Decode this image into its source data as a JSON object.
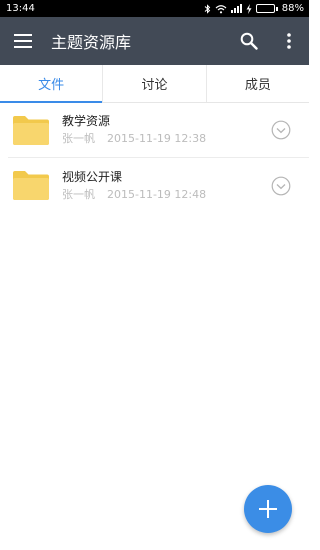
{
  "status_bar": {
    "time": "13:44",
    "battery_percent": "88%",
    "battery_level": 0.88
  },
  "app_bar": {
    "title": "主题资源库",
    "menu_icon": "menu-icon",
    "search_icon": "search-icon",
    "more_icon": "more-vert-icon"
  },
  "tabs": [
    {
      "label": "文件",
      "active": true
    },
    {
      "label": "讨论",
      "active": false
    },
    {
      "label": "成员",
      "active": false
    }
  ],
  "files": [
    {
      "name": "教学资源",
      "owner": "张一帆",
      "date": "2015-11-19 12:38",
      "icon": "folder-icon"
    },
    {
      "name": "视频公开课",
      "owner": "张一帆",
      "date": "2015-11-19 12:48",
      "icon": "folder-icon"
    }
  ],
  "fab": {
    "icon": "plus-icon"
  },
  "colors": {
    "app_bar": "#424a56",
    "accent": "#3a8be8",
    "folder": "#f8d66d",
    "fab": "#3b8de6"
  }
}
